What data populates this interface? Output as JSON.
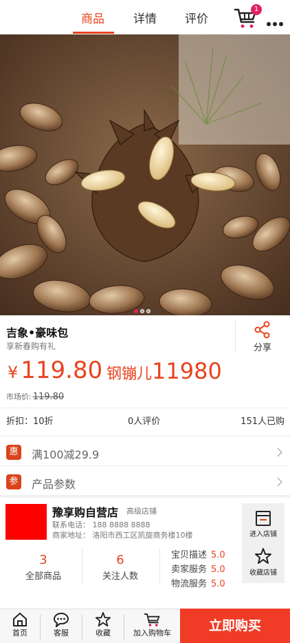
{
  "nav": {
    "tabs": [
      {
        "label": "商品",
        "active": true
      },
      {
        "label": "详情",
        "active": false
      },
      {
        "label": "评价",
        "active": false
      }
    ],
    "cart_badge": "1",
    "accent_color": "#e8431d"
  },
  "gallery": {
    "slide_count": 3,
    "active_index": 0
  },
  "product": {
    "title": "吉象•豪味包",
    "subtitle": "享新春购有礼",
    "share_label": "分享",
    "price_symbol": "¥",
    "price": "119.80",
    "alt_price_label": "钢镚儿",
    "alt_price": "11980",
    "market_label": "市场价:",
    "market_price": "119.80",
    "discount": "折扣：10折",
    "reviews": "0人评价",
    "sold": "151人已购"
  },
  "rows": [
    {
      "tag": "惠",
      "text": "满100减29.9"
    },
    {
      "tag": "参",
      "text": "产品参数"
    }
  ],
  "store": {
    "name": "豫享购自营店",
    "level": "高级店铺",
    "phone": "联系电话：  188 8888 8888",
    "address": "商家地址：  洛阳市西工区凯旋商务楼10楼",
    "enter_label": "进入店铺",
    "favorite_label": "收藏店铺",
    "metrics": [
      {
        "num": "3",
        "label": "全部商品"
      },
      {
        "num": "6",
        "label": "关注人数"
      }
    ],
    "ratings": [
      {
        "label": "宝贝描述",
        "value": "5.0"
      },
      {
        "label": "卖家服务",
        "value": "5.0"
      },
      {
        "label": "物流服务",
        "value": "5.0"
      }
    ]
  },
  "bottom_bar": {
    "home": "首页",
    "service": "客服",
    "favorite": "收藏",
    "add_cart": "加入购物车",
    "buy_now": "立即购买"
  }
}
